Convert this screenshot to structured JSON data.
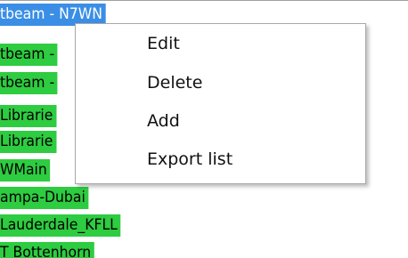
{
  "list": {
    "items": [
      {
        "label": "tbeam - N7WN",
        "selected": true
      },
      {
        "label": "tbeam - ",
        "selected": false
      },
      {
        "label": "tbeam - ",
        "selected": false
      },
      {
        "label": "Librarie",
        "selected": false
      },
      {
        "label": "Librarie",
        "selected": false
      },
      {
        "label": "WMain",
        "selected": false
      },
      {
        "label": "ampa-Dubai",
        "selected": false
      },
      {
        "label": "Lauderdale_KFLL",
        "selected": false
      },
      {
        "label": "T Bottenhorn",
        "selected": false
      }
    ]
  },
  "context_menu": {
    "items": [
      {
        "label": "Edit"
      },
      {
        "label": "Delete"
      },
      {
        "label": "Add"
      },
      {
        "label": "Export list"
      }
    ]
  },
  "colors": {
    "selection_blue": "#3a8ee6",
    "item_green": "#2ecc40",
    "menu_background": "#ffffff"
  }
}
